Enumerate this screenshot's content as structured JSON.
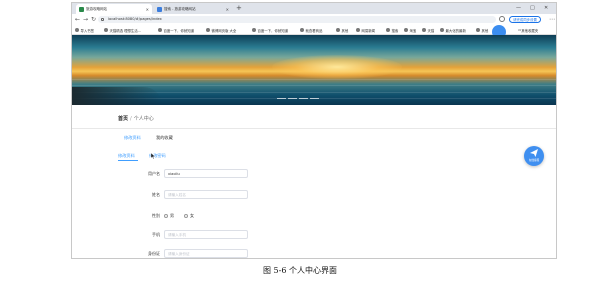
{
  "browser": {
    "tabs": [
      {
        "title": "旅游攻略网站",
        "icon_color": "#2a8a4a",
        "active": true
      },
      {
        "title": "搜索 - 旅游攻略网站",
        "icon_color": "#3b7ddd",
        "active": false
      }
    ],
    "new_tab": "+",
    "window_controls": [
      "—",
      "□",
      "✕"
    ],
    "url": "localhost:8080/#/pages/index",
    "profile_button": "请完成同步设置",
    "bookmarks": [
      "导入书签",
      "天猫精选 理想生活...",
      "百度一下，你就知道",
      "微博网页版 大全",
      "百度一下，你就知道",
      "就查看商品",
      "其他",
      "网易新闻",
      "搜索",
      "淘宝",
      "天猫",
      "最大化的最新",
      "其他"
    ],
    "bookmark_overflow": "其他收藏夹"
  },
  "breadcrumb": {
    "home": "首页",
    "sep": "/",
    "current": "个人中心"
  },
  "page_tabs": [
    "修改资料",
    "我的收藏"
  ],
  "sub_tabs": [
    "修改资料",
    "修改密码"
  ],
  "form": {
    "username_label": "用户名",
    "username_value": "xiaoliu",
    "name_label": "姓名",
    "name_placeholder": "请输入姓名",
    "gender_label": "性别",
    "gender_options": [
      "男",
      "女"
    ],
    "phone_label": "手机",
    "phone_placeholder": "请输入手机",
    "id_label": "身份证",
    "id_placeholder": "请输入身份证"
  },
  "fab_label": "在线客服",
  "caption": "图 5-6 个人中心界面"
}
